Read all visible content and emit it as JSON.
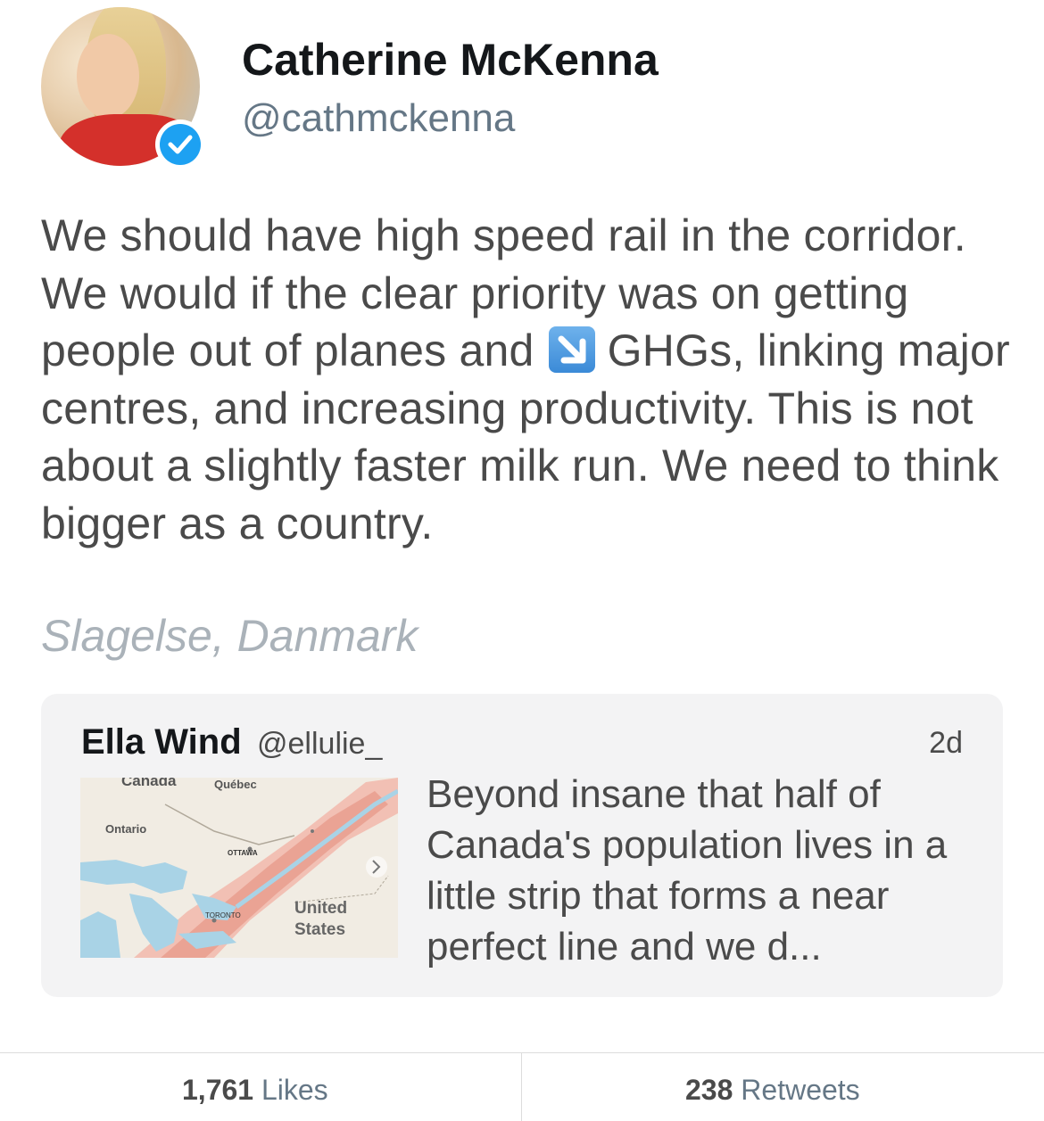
{
  "author": {
    "name": "Catherine McKenna",
    "handle": "@cathmckenna",
    "verified": true
  },
  "tweet": {
    "text_part1": "We should have high speed rail in the corridor. We would if the clear priority was on getting people out of planes and ",
    "emoji": "down-right-arrow-emoji",
    "text_part2": " GHGs, linking major centres, and increasing productivity. This is not about a slightly faster milk run. We need to think bigger as a country.",
    "location": "Slagelse, Danmark"
  },
  "quoted_tweet": {
    "name": "Ella Wind",
    "handle": "@ellulie_",
    "time": "2d",
    "text": "Beyond insane that half of Canada's population lives in a little strip that forms a near perfect line and we d...",
    "map_labels": {
      "canada": "Canada",
      "quebec": "Québec",
      "ontario": "Ontario",
      "ottawa": "OTTAWA",
      "toronto": "TORONTO",
      "us_line1": "United",
      "us_line2": "States"
    }
  },
  "stats": {
    "likes_count": "1,761",
    "likes_label": "Likes",
    "retweets_count": "238",
    "retweets_label": "Retweets"
  },
  "colors": {
    "verified_blue": "#1da1f2",
    "text_gray": "#4a4a4a",
    "location_gray": "#aab2b9",
    "quote_bg": "#f3f3f4"
  }
}
